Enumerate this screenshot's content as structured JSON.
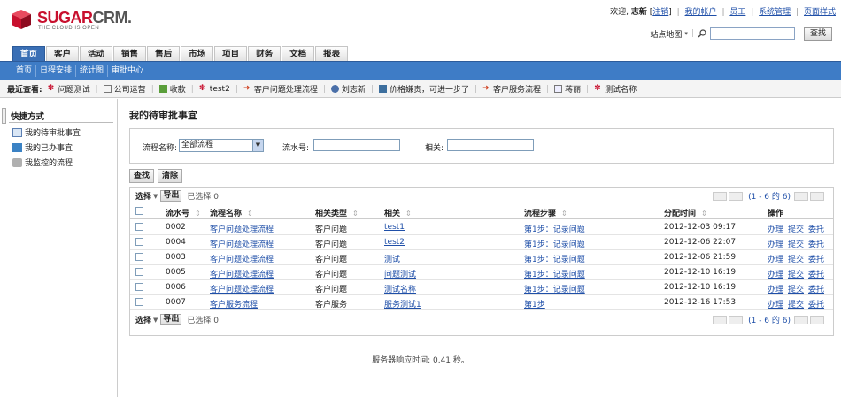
{
  "header": {
    "logo_brand_red": "SUGAR",
    "logo_brand_grey": "CRM.",
    "logo_tagline": "THE CLOUD IS OPEN",
    "welcome_prefix": "欢迎,",
    "username": "志新",
    "logout": "注销",
    "links": [
      "我的帐户",
      "员工",
      "系统管理",
      "页面样式"
    ],
    "sitemap": "站点地图",
    "search_button": "查找",
    "search_value": ""
  },
  "main_tabs": [
    "首页",
    "客户",
    "活动",
    "销售",
    "售后",
    "市场",
    "项目",
    "财务",
    "文档",
    "报表"
  ],
  "sub_tabs": [
    "首页",
    "日程安排",
    "统计图",
    "审批中心"
  ],
  "recent": {
    "label": "最近查看:",
    "items": [
      "问题测试",
      "公司运营",
      "收款",
      "test2",
      "客户问题处理流程",
      "刘志新",
      "价格嫌贵，可进一步了",
      "客户服务流程",
      "蒋丽",
      "测试名称"
    ]
  },
  "sidebar": {
    "title": "快捷方式",
    "items": [
      "我的待审批事宜",
      "我的已办事宜",
      "我监控的流程"
    ]
  },
  "page": {
    "title": "我的待审批事宜",
    "filter": {
      "flow_name_label": "流程名称:",
      "flow_name_value": "全部流程",
      "serial_label": "流水号:",
      "serial_value": "",
      "related_label": "相关:",
      "related_value": ""
    },
    "search_btn": "查找",
    "clear_btn": "清除"
  },
  "list": {
    "select_label": "选择",
    "export_label": "导出",
    "selected_text": "已选择 0",
    "pager_info": "(1 - 6 的 6)",
    "columns": [
      "流水号",
      "流程名称",
      "相关类型",
      "相关",
      "流程步骤",
      "分配时间",
      "操作"
    ],
    "rows": [
      {
        "no": "0002",
        "flow": "客户问题处理流程",
        "type": "客户问题",
        "rel": "test1",
        "step": "第1步：记录问题",
        "time": "2012-12-03 09:17"
      },
      {
        "no": "0004",
        "flow": "客户问题处理流程",
        "type": "客户问题",
        "rel": "test2",
        "step": "第1步：记录问题",
        "time": "2012-12-06 22:07"
      },
      {
        "no": "0003",
        "flow": "客户问题处理流程",
        "type": "客户问题",
        "rel": "测试",
        "step": "第1步：记录问题",
        "time": "2012-12-06 21:59"
      },
      {
        "no": "0005",
        "flow": "客户问题处理流程",
        "type": "客户问题",
        "rel": "问题测试",
        "step": "第1步：记录问题",
        "time": "2012-12-10 16:19"
      },
      {
        "no": "0006",
        "flow": "客户问题处理流程",
        "type": "客户问题",
        "rel": "测试名称",
        "step": "第1步：记录问题",
        "time": "2012-12-10 16:19"
      },
      {
        "no": "0007",
        "flow": "客户服务流程",
        "type": "客户服务",
        "rel": "服务测试1",
        "step": "第1步",
        "time": "2012-12-16 17:53"
      }
    ],
    "actions": [
      "办理",
      "提交",
      "委托"
    ]
  },
  "footer": {
    "text": "服务器响应时间: 0.41 秒。"
  },
  "colors": {
    "brand_red": "#c8102e",
    "nav_blue": "#3e7cc6",
    "link_blue": "#1f4fa8"
  }
}
